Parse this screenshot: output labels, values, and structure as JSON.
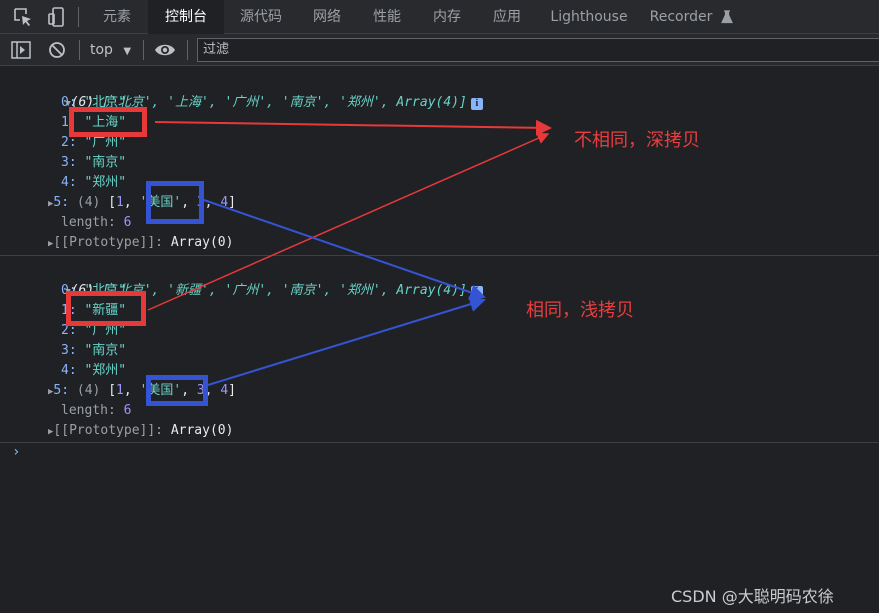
{
  "tabs": [
    {
      "label": "元素",
      "active": false
    },
    {
      "label": "控制台",
      "active": true
    },
    {
      "label": "源代码",
      "active": false
    },
    {
      "label": "网络",
      "active": false
    },
    {
      "label": "性能",
      "active": false
    },
    {
      "label": "内存",
      "active": false
    },
    {
      "label": "应用",
      "active": false
    },
    {
      "label": "Lighthouse",
      "active": false
    },
    {
      "label": "Recorder",
      "active": false
    }
  ],
  "toolbar": {
    "context": "top",
    "filter_placeholder": "过滤"
  },
  "console": {
    "array1": {
      "summary_prefix": "(6) ",
      "summary": "['北京', '上海', '广州', '南京', '郑州', Array(4)]",
      "items": [
        {
          "key": "0",
          "value": "\"北京\""
        },
        {
          "key": "1",
          "value": "\"上海\""
        },
        {
          "key": "2",
          "value": "\"广州\""
        },
        {
          "key": "3",
          "value": "\"南京\""
        },
        {
          "key": "4",
          "value": "\"郑州\""
        }
      ],
      "nested": {
        "key": "5",
        "prefix": "(4) ",
        "open": "[",
        "a": "1",
        "b": "'美国'",
        "c": "3",
        "d": "4",
        "close": "]"
      },
      "length_key": "length",
      "length_value": "6",
      "prototype": "[[Prototype]]",
      "prototype_value": "Array(0)"
    },
    "array2": {
      "summary_prefix": "(6) ",
      "summary": "['北京', '新疆', '广州', '南京', '郑州', Array(4)]",
      "items": [
        {
          "key": "0",
          "value": "\"北京\""
        },
        {
          "key": "1",
          "value": "\"新疆\""
        },
        {
          "key": "2",
          "value": "\"广州\""
        },
        {
          "key": "3",
          "value": "\"南京\""
        },
        {
          "key": "4",
          "value": "\"郑州\""
        }
      ],
      "nested": {
        "key": "5",
        "prefix": "(4) ",
        "open": "[",
        "a": "1",
        "b": "'美国'",
        "c": "3",
        "d": "4",
        "close": "]"
      },
      "length_key": "length",
      "length_value": "6",
      "prototype": "[[Prototype]]",
      "prototype_value": "Array(0)"
    },
    "prompt": "›"
  },
  "annotations": {
    "deep_copy_note": "不相同，深拷贝",
    "shallow_copy_note": "相同，浅拷贝",
    "red_color": "#e8393a",
    "blue_color": "#3554d4"
  },
  "watermark": "CSDN @大聪明码农徐"
}
